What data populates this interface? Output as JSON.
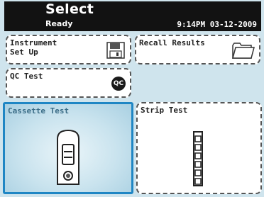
{
  "header": {
    "title": "Select",
    "status": "Ready",
    "datetime": "9:14PM  03-12-2009"
  },
  "buttons": {
    "instrument_setup": "Instrument\nSet Up",
    "recall_results": "Recall Results",
    "qc_test": "QC Test",
    "qc_badge": "QC",
    "cassette_test": "Cassette Test",
    "strip_test": "Strip Test"
  },
  "colors": {
    "header_bg": "#121212",
    "selected_border": "#1f86c4",
    "screen_bg": "#cfe4ed"
  },
  "icons": {
    "instrument_setup": "floppy-disk-icon",
    "recall_results": "folder-icon",
    "qc_test": "qc-badge-icon",
    "cassette_test": "cassette-icon",
    "strip_test": "test-strip-icon"
  },
  "selected": "cassette_test"
}
